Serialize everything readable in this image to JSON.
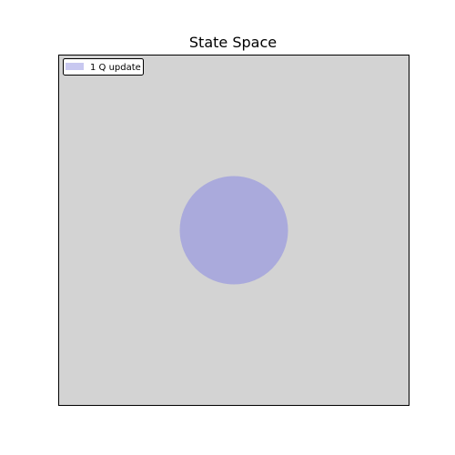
{
  "chart_data": {
    "type": "scatter",
    "title": "State Space",
    "xlabel": "",
    "ylabel": "",
    "grid": false,
    "legend_position": "top-left",
    "background_color": "#d3d3d3",
    "series": [
      {
        "name": "1 Q update",
        "color": "#aaaadc",
        "legend_color": "#c8c8f0",
        "marker": "circle",
        "points": [
          {
            "x": 0.5,
            "y": 0.5
          }
        ]
      }
    ],
    "xlim": [
      0,
      1
    ],
    "ylim": [
      0,
      1
    ]
  }
}
